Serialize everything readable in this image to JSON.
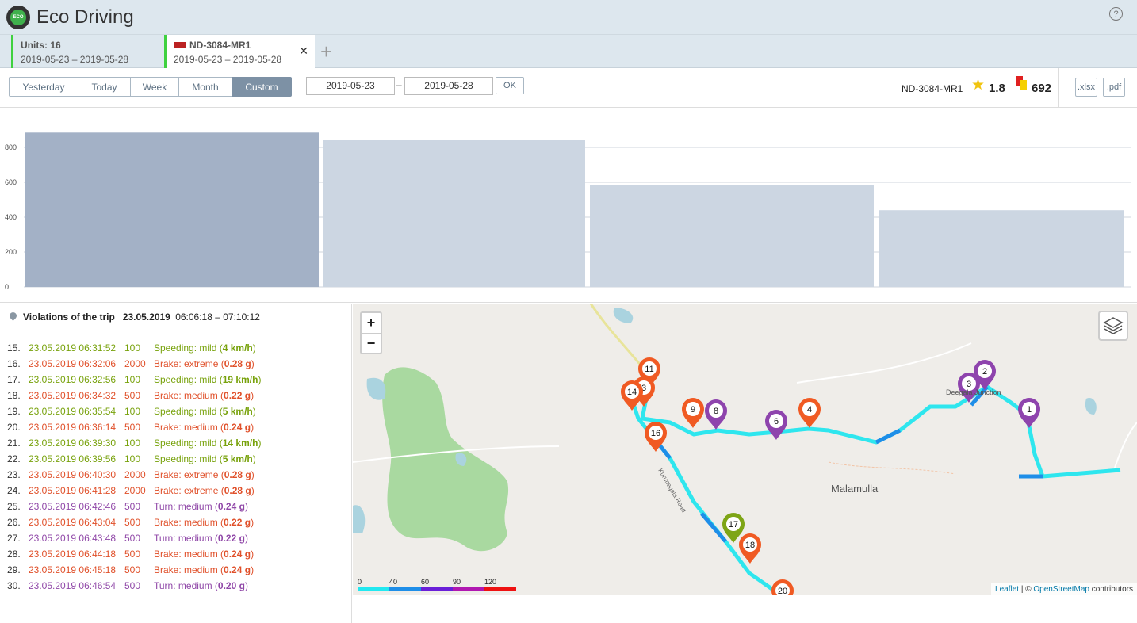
{
  "app": {
    "title": "Eco Driving",
    "logo_text": "ECO",
    "help": "?"
  },
  "tabs": [
    {
      "title": "Units: 16",
      "range": "2019-05-23  –  2019-05-28"
    },
    {
      "title": "ND-3084-MR1",
      "range": "2019-05-23  –  2019-05-28",
      "close": "✕"
    }
  ],
  "add_tab": "+",
  "periods": [
    "Yesterday",
    "Today",
    "Week",
    "Month",
    "Custom"
  ],
  "active_period": "Custom",
  "date_from": "2019-05-23",
  "date_to": "2019-05-28",
  "date_sep": "–",
  "ok_label": "OK",
  "unit": {
    "name": "ND-3084-MR1",
    "rating": "1.8",
    "penalty": "692"
  },
  "export": {
    "xlsx": ".xlsx",
    "pdf": ".pdf"
  },
  "chart_data": {
    "type": "bar",
    "categories": [
      "",
      "",
      "",
      ""
    ],
    "values": [
      885,
      845,
      585,
      440
    ],
    "yticks": [
      "0",
      "200",
      "400",
      "600",
      "800"
    ],
    "ylim": [
      0,
      1000
    ],
    "bar_colors": [
      "#a3b1c6",
      "#ccd6e2",
      "#ccd6e2",
      "#ccd6e2"
    ],
    "grid": true
  },
  "violations": {
    "title": "Violations of the trip",
    "date": "23.05.2019",
    "time_range": "06:06:18 – 07:10:12",
    "rows": [
      {
        "n": "15.",
        "time": "23.05.2019 06:31:52",
        "val": "100",
        "label": "Speeding: mild",
        "amount": "4 km/h",
        "color": "green"
      },
      {
        "n": "16.",
        "time": "23.05.2019 06:32:06",
        "val": "2000",
        "label": "Brake: extreme",
        "amount": "0.28 g",
        "color": "red"
      },
      {
        "n": "17.",
        "time": "23.05.2019 06:32:56",
        "val": "100",
        "label": "Speeding: mild",
        "amount": "19 km/h",
        "color": "green"
      },
      {
        "n": "18.",
        "time": "23.05.2019 06:34:32",
        "val": "500",
        "label": "Brake: medium",
        "amount": "0.22 g",
        "color": "red"
      },
      {
        "n": "19.",
        "time": "23.05.2019 06:35:54",
        "val": "100",
        "label": "Speeding: mild",
        "amount": "5 km/h",
        "color": "green"
      },
      {
        "n": "20.",
        "time": "23.05.2019 06:36:14",
        "val": "500",
        "label": "Brake: medium",
        "amount": "0.24 g",
        "color": "red"
      },
      {
        "n": "21.",
        "time": "23.05.2019 06:39:30",
        "val": "100",
        "label": "Speeding: mild",
        "amount": "14 km/h",
        "color": "green"
      },
      {
        "n": "22.",
        "time": "23.05.2019 06:39:56",
        "val": "100",
        "label": "Speeding: mild",
        "amount": "5 km/h",
        "color": "green"
      },
      {
        "n": "23.",
        "time": "23.05.2019 06:40:30",
        "val": "2000",
        "label": "Brake: extreme",
        "amount": "0.28 g",
        "color": "red"
      },
      {
        "n": "24.",
        "time": "23.05.2019 06:41:28",
        "val": "2000",
        "label": "Brake: extreme",
        "amount": "0.28 g",
        "color": "red"
      },
      {
        "n": "25.",
        "time": "23.05.2019 06:42:46",
        "val": "500",
        "label": "Turn: medium",
        "amount": "0.24 g",
        "color": "purple"
      },
      {
        "n": "26.",
        "time": "23.05.2019 06:43:04",
        "val": "500",
        "label": "Brake: medium",
        "amount": "0.22 g",
        "color": "red"
      },
      {
        "n": "27.",
        "time": "23.05.2019 06:43:48",
        "val": "500",
        "label": "Turn: medium",
        "amount": "0.22 g",
        "color": "purple"
      },
      {
        "n": "28.",
        "time": "23.05.2019 06:44:18",
        "val": "500",
        "label": "Brake: medium",
        "amount": "0.24 g",
        "color": "red"
      },
      {
        "n": "29.",
        "time": "23.05.2019 06:45:18",
        "val": "500",
        "label": "Brake: medium",
        "amount": "0.24 g",
        "color": "red"
      },
      {
        "n": "30.",
        "time": "23.05.2019 06:46:54",
        "val": "500",
        "label": "Turn: medium",
        "amount": "0.20 g",
        "color": "purple"
      }
    ]
  },
  "map": {
    "zoom_in": "+",
    "zoom_out": "−",
    "place_names": [
      "Malamulla",
      "Deegala Junction"
    ],
    "speed_legend": [
      "0",
      "40",
      "60",
      "90",
      "120"
    ],
    "speed_colors": [
      "#22e8f0",
      "#1e8ee8",
      "#6a1fd8",
      "#b018b0",
      "#ee1111"
    ],
    "markers": [
      {
        "label": "1",
        "color": "purple"
      },
      {
        "label": "2",
        "color": "purple"
      },
      {
        "label": "3",
        "color": "purple"
      },
      {
        "label": "4",
        "color": "red"
      },
      {
        "label": "6",
        "color": "purple"
      },
      {
        "label": "8",
        "color": "purple"
      },
      {
        "label": "9",
        "color": "red"
      },
      {
        "label": "11",
        "color": "red"
      },
      {
        "label": "3",
        "color": "red"
      },
      {
        "label": "14",
        "color": "red"
      },
      {
        "label": "16",
        "color": "red"
      },
      {
        "label": "17",
        "color": "green"
      },
      {
        "label": "18",
        "color": "red"
      },
      {
        "label": "20",
        "color": "red"
      }
    ],
    "attribution": {
      "leaflet": "Leaflet",
      "sep": " | © ",
      "osm": "OpenStreetMap",
      "rest": " contributors"
    }
  }
}
